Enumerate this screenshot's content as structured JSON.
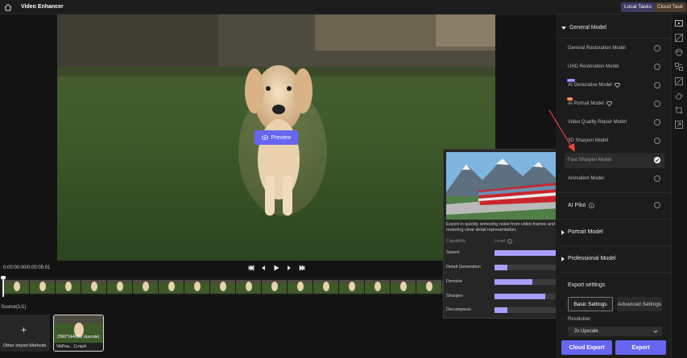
{
  "app": {
    "title": "Video Enhancer"
  },
  "topbar": {
    "local_tasks": "Local Tasks",
    "cloud_task": "Cloud Task"
  },
  "preview": {
    "label": "Preview"
  },
  "player": {
    "timecode": "0:00:00:00/0:00:05:01"
  },
  "source": {
    "label": "Source(1/1)",
    "import_label": "Other Import Methods",
    "clip_resolution": "2560*1440(2x Upscale)",
    "clip_name": "VikPea... 1).mp4"
  },
  "popup": {
    "description": "Expert in quickly removing noise from video frames and restoring clear detail representation.",
    "capability_header": "Capability",
    "level_header": "Level",
    "capabilities": [
      {
        "label": "Speed",
        "level": 1.0
      },
      {
        "label": "Detail Generation",
        "level": 0.2
      },
      {
        "label": "Denoise",
        "level": 0.6
      },
      {
        "label": "Sharpen",
        "level": 0.8
      },
      {
        "label": "Decompress",
        "level": 0.2
      }
    ]
  },
  "panel": {
    "general_model": "General Model",
    "models": [
      {
        "label": "General Restoration Model"
      },
      {
        "label": "UHD Restoration Model"
      },
      {
        "label": "AI Generative Model",
        "badge": "NEW"
      },
      {
        "label": "AI Portrait Model",
        "badge": "Hot"
      },
      {
        "label": "Video Quality Repair Model"
      },
      {
        "label": "3D Sharpen Model"
      },
      {
        "label": "Fast Sharpen Model",
        "selected": true
      },
      {
        "label": "Animation Model"
      }
    ],
    "ai_pilot": "AI Pilot",
    "portrait_model": "Portrait Model",
    "professional_model": "Professional Model",
    "export_settings": "Export settings",
    "basic_settings": "Basic Settings",
    "advanced_settings": "Advanced Settings",
    "resolution_label": "Resolution",
    "resolution_value": "2x Upscale",
    "cloud_export": "Cloud Export",
    "export": "Export"
  },
  "colors": {
    "accent": "#6766f0",
    "arrow": "#e8473a",
    "capability_fill": "#a8a0ff"
  }
}
